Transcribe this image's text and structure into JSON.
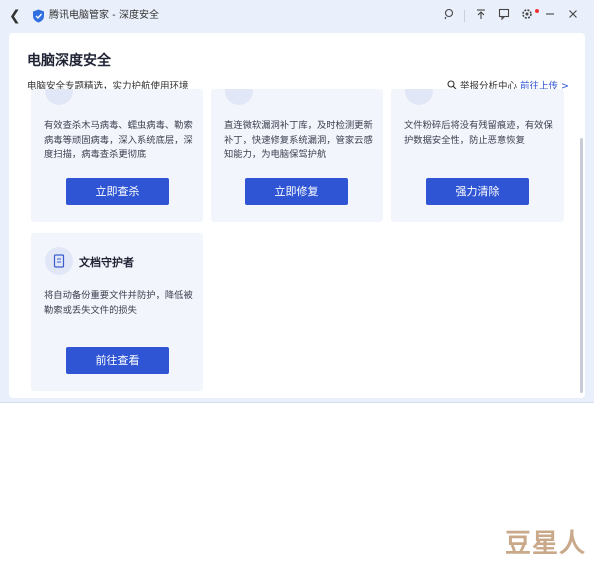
{
  "window": {
    "title": "腾讯电脑管家 - 深度安全",
    "icons": [
      "back-icon",
      "shield-logo-icon",
      "skin-icon",
      "upload-icon",
      "feedback-icon",
      "settings-icon",
      "minimize-icon",
      "close-icon"
    ]
  },
  "header": {
    "title": "电脑深度安全",
    "subtitle": "电脑安全专题精选，实力护航使用环境",
    "report_prefix": "举报分析中心",
    "report_link": "前往上传 >"
  },
  "cards": [
    {
      "desc": "有效查杀木马病毒、蠕虫病毒、勒索病毒等顽固病毒，深入系统底层，深度扫描，病毒查杀更彻底",
      "button": "立即查杀"
    },
    {
      "desc": "直连微软漏洞补丁库，及时检测更新补丁，快速修复系统漏洞，管家云感知能力，为电脑保驾护航",
      "button": "立即修复"
    },
    {
      "desc": "文件粉碎后将没有残留痕迹，有效保护数据安全性，防止恶意恢复",
      "button": "强力清除"
    },
    {
      "title": "文档守护者",
      "desc": "将自动备份重要文件并防护，降低被勒索或丢失文件的损失",
      "button": "前往查看"
    }
  ],
  "watermark": "豆星人",
  "colors": {
    "accent": "#2f55d4",
    "card_bg": "#f3f5fd",
    "window_bg": "#eaf0fb"
  }
}
